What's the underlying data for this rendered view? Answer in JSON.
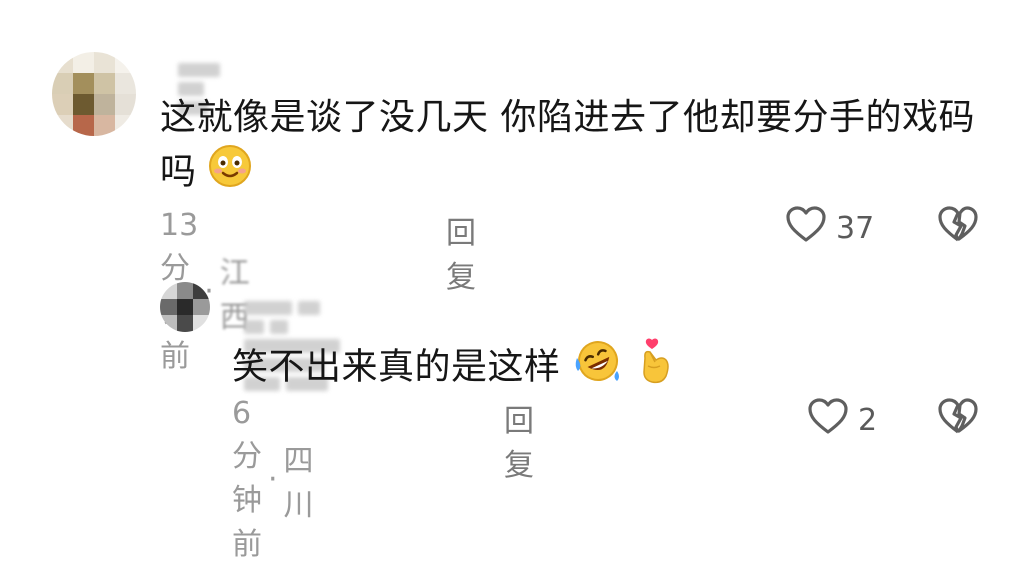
{
  "comments": [
    {
      "text": "这就像是谈了没几天 你陷进去了他却要分手的戏码吗",
      "emoji": "smiling-face-emoji",
      "time": "13分钟前",
      "location": "江西",
      "reply_label": "回复",
      "likes": "37",
      "colors": {
        "text": "#161616",
        "meta": "#9a9a9a"
      }
    },
    {
      "text": "笑不出来真的是这样",
      "emojis": [
        "rolling-on-floor-laughing-emoji",
        "finger-heart-emoji"
      ],
      "time": "6分钟前",
      "location": "四川",
      "reply_label": "回复",
      "likes": "2"
    }
  ]
}
